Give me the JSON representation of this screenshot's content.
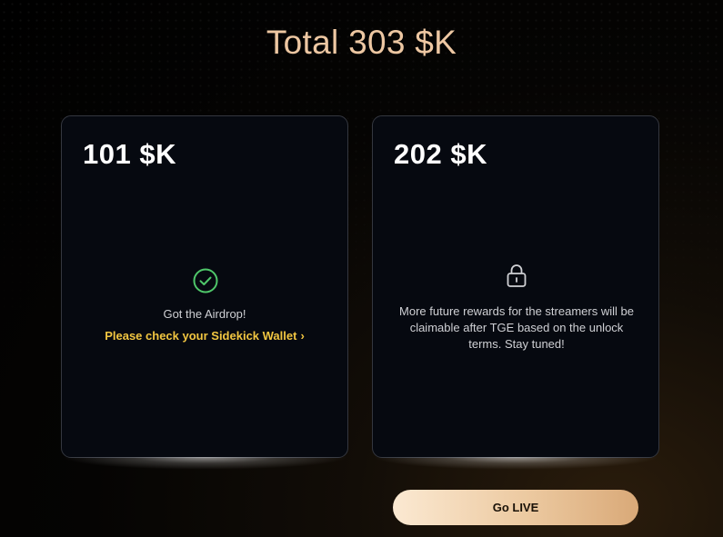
{
  "header": {
    "title": "Total 303 $K"
  },
  "cards": [
    {
      "amount": "101 $K",
      "icon": "check-circle-icon",
      "status_text": "Got the Airdrop!",
      "link_text": "Please check your Sidekick Wallet",
      "link_chevron": "›"
    },
    {
      "amount": "202 $K",
      "icon": "lock-icon",
      "info_text": "More future rewards for the streamers will be claimable after TGE based on the unlock terms. Stay tuned!"
    }
  ],
  "actions": {
    "go_live_label": "Go LIVE"
  },
  "colors": {
    "title": "#edc7a2",
    "success": "#4fc76a",
    "link": "#f2c641",
    "card_bg": "#060910",
    "card_border": "#34373f",
    "button_gradient_start": "#fbe9d2",
    "button_gradient_end": "#d9a978"
  }
}
